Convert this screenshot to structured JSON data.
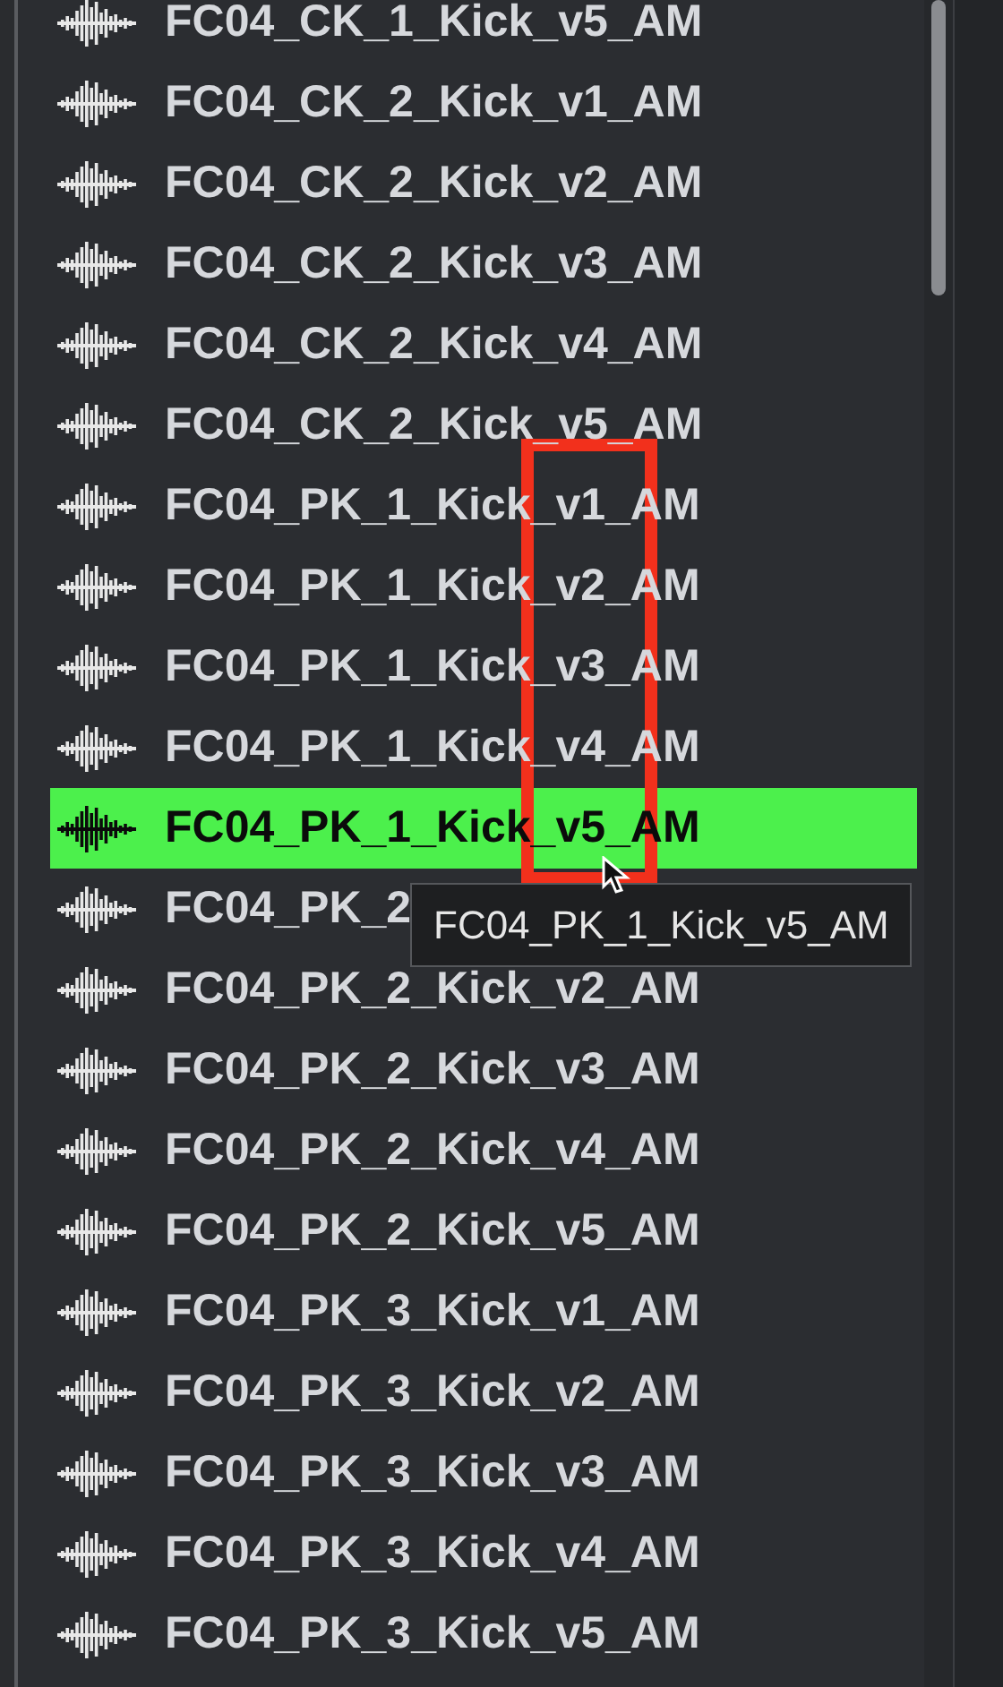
{
  "rows": [
    {
      "name": "FC04_CK_1_Kick_v5_AM",
      "selected": false
    },
    {
      "name": "FC04_CK_2_Kick_v1_AM",
      "selected": false
    },
    {
      "name": "FC04_CK_2_Kick_v2_AM",
      "selected": false
    },
    {
      "name": "FC04_CK_2_Kick_v3_AM",
      "selected": false
    },
    {
      "name": "FC04_CK_2_Kick_v4_AM",
      "selected": false
    },
    {
      "name": "FC04_CK_2_Kick_v5_AM",
      "selected": false
    },
    {
      "name": "FC04_PK_1_Kick_v1_AM",
      "selected": false
    },
    {
      "name": "FC04_PK_1_Kick_v2_AM",
      "selected": false
    },
    {
      "name": "FC04_PK_1_Kick_v3_AM",
      "selected": false
    },
    {
      "name": "FC04_PK_1_Kick_v4_AM",
      "selected": false
    },
    {
      "name": "FC04_PK_1_Kick_v5_AM",
      "selected": true
    },
    {
      "name": "FC04_PK_2",
      "selected": false
    },
    {
      "name": "FC04_PK_2_Kick_v2_AM",
      "selected": false
    },
    {
      "name": "FC04_PK_2_Kick_v3_AM",
      "selected": false
    },
    {
      "name": "FC04_PK_2_Kick_v4_AM",
      "selected": false
    },
    {
      "name": "FC04_PK_2_Kick_v5_AM",
      "selected": false
    },
    {
      "name": "FC04_PK_3_Kick_v1_AM",
      "selected": false
    },
    {
      "name": "FC04_PK_3_Kick_v2_AM",
      "selected": false
    },
    {
      "name": "FC04_PK_3_Kick_v3_AM",
      "selected": false
    },
    {
      "name": "FC04_PK_3_Kick_v4_AM",
      "selected": false
    },
    {
      "name": "FC04_PK_3_Kick_v5_AM",
      "selected": false
    }
  ],
  "tooltip": {
    "text": "FC04_PK_1_Kick_v5_AM"
  }
}
